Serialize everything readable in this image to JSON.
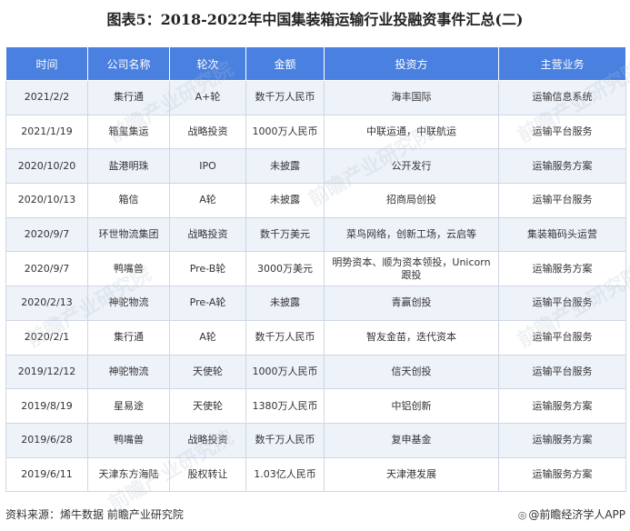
{
  "title": "图表5：2018-2022年中国集装箱运输行业投融资事件汇总(二)",
  "headers": [
    "时间",
    "公司名称",
    "轮次",
    "金额",
    "投资方",
    "主营业务"
  ],
  "rows": [
    [
      "2021/2/2",
      "集行通",
      "A+轮",
      "数千万人民币",
      "海丰国际",
      "运输信息系统"
    ],
    [
      "2021/1/19",
      "箱玺集运",
      "战略投资",
      "1000万人民币",
      "中联运通，中联航运",
      "运输平台服务"
    ],
    [
      "2020/10/20",
      "盐港明珠",
      "IPO",
      "未披露",
      "公开发行",
      "运输服务方案"
    ],
    [
      "2020/10/13",
      "箱信",
      "A轮",
      "未披露",
      "招商局创投",
      "运输平台服务"
    ],
    [
      "2020/9/7",
      "环世物流集团",
      "战略投资",
      "数千万美元",
      "菜鸟网络，创新工场，云启等",
      "集装箱码头运营"
    ],
    [
      "2020/9/7",
      "鸭嘴兽",
      "Pre-B轮",
      "3000万美元",
      "明势资本、顺为资本领投，Unicorn跟投",
      "运输服务方案"
    ],
    [
      "2020/2/13",
      "神驼物流",
      "Pre-A轮",
      "未披露",
      "青赢创投",
      "运输平台服务"
    ],
    [
      "2020/2/1",
      "集行通",
      "A轮",
      "数千万人民币",
      "智友金苗，迭代资本",
      "运输平台服务"
    ],
    [
      "2019/12/12",
      "神驼物流",
      "天使轮",
      "1000万人民币",
      "信天创投",
      "运输平台服务"
    ],
    [
      "2019/8/19",
      "星易途",
      "天使轮",
      "1380万人民币",
      "中铝创新",
      "运输服务方案"
    ],
    [
      "2019/6/28",
      "鸭嘴兽",
      "战略投资",
      "数千万人民币",
      "复申基金",
      "运输服务方案"
    ],
    [
      "2019/6/11",
      "天津东方海陆",
      "股权转让",
      "1.03亿人民币",
      "天津港发展",
      "运输服务方案"
    ]
  ],
  "footer": {
    "source": "资料来源：烯牛数据 前瞻产业研究院",
    "brand": "@前瞻经济学人APP",
    "brand_icon": "qianzhan-logo-icon"
  },
  "watermark": "前瞻产业研究院",
  "colors": {
    "header_bg": "#4a80e0",
    "row_alt": "#eef2f9"
  }
}
